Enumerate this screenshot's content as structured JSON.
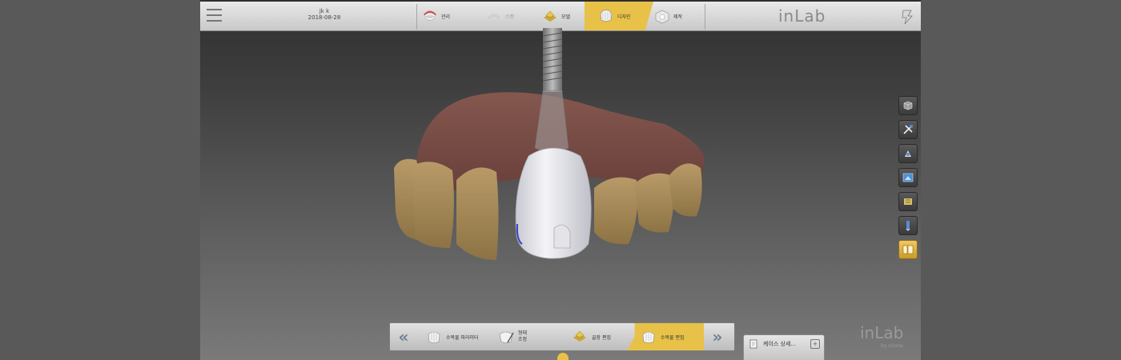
{
  "header": {
    "patient_name": "jk  k",
    "patient_date": "2018-08-28"
  },
  "phases": [
    {
      "label": "관리",
      "icon": "dentition-icon",
      "state": "normal"
    },
    {
      "label": "스캔",
      "icon": "scan-icon",
      "state": "disabled"
    },
    {
      "label": "모델",
      "icon": "model-icon",
      "state": "normal"
    },
    {
      "label": "디자인",
      "icon": "design-icon",
      "state": "active"
    },
    {
      "label": "제작",
      "icon": "manufacture-icon",
      "state": "normal"
    }
  ],
  "brand": "inLab",
  "toolbar": [
    {
      "icon": "view-cube-icon"
    },
    {
      "icon": "tools-icon"
    },
    {
      "icon": "analysis-icon"
    },
    {
      "icon": "screenshot-icon"
    },
    {
      "icon": "model-object-icon"
    },
    {
      "icon": "implant-icon"
    },
    {
      "icon": "library-icon",
      "active": true
    }
  ],
  "steps": [
    {
      "label": "수복물 파라미터",
      "icon": "crown-params-icon"
    },
    {
      "label": "형태",
      "label2": "조정",
      "icon": "shape-adjust-icon"
    },
    {
      "label": "골장 편집",
      "icon": "abutment-edit-icon"
    },
    {
      "label": "수복물 편집",
      "icon": "crown-edit-icon",
      "active": true
    }
  ],
  "case_panel": {
    "label": "케이스 상세..."
  },
  "watermark": {
    "text": "inLab",
    "sub": "by sirona"
  },
  "colors": {
    "accent": "#e8c148",
    "nav_arrow": "#6f7e95"
  }
}
